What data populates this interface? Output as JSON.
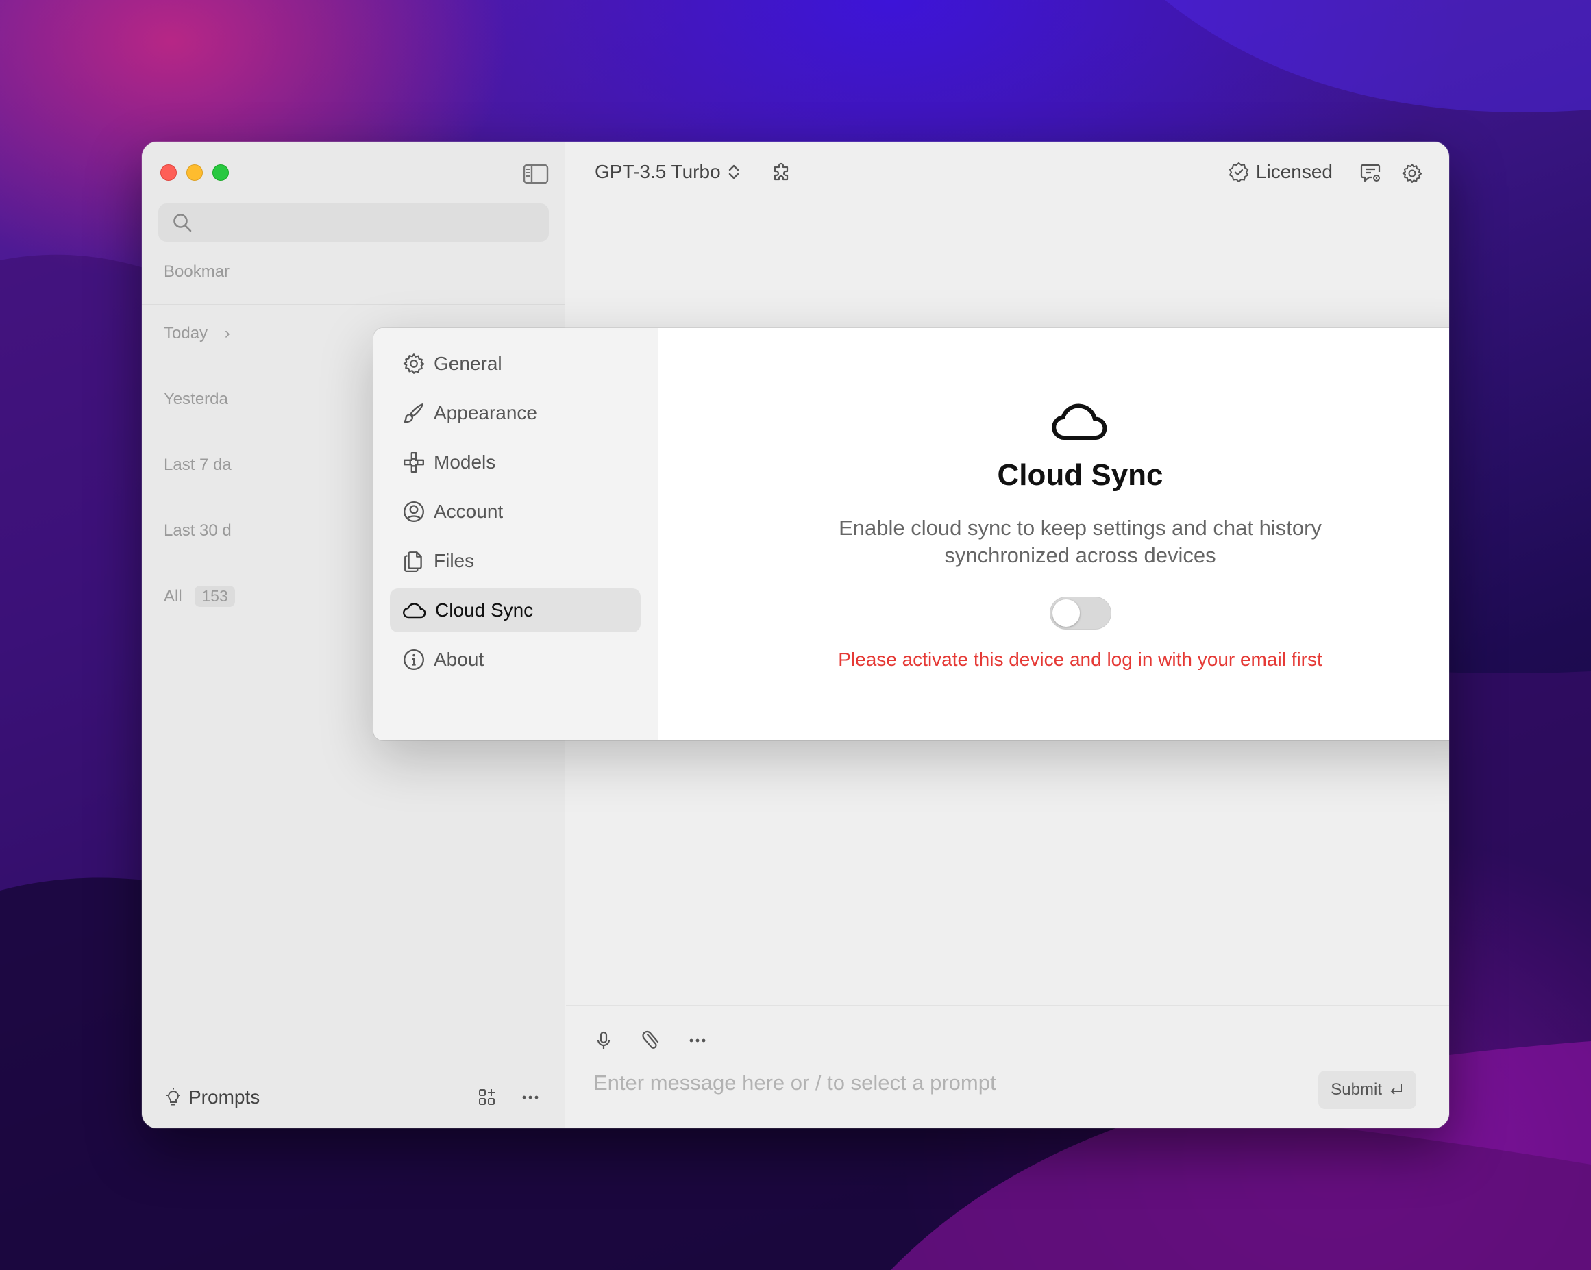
{
  "sidebar": {
    "search_placeholder": "",
    "sections": {
      "bookmarks": "Bookmar",
      "today": "Today",
      "today_chevron": "›",
      "yesterday": "Yesterda",
      "last7": "Last 7 da",
      "last30": "Last 30 d",
      "all": "All",
      "all_count": "153"
    },
    "footer": {
      "prompts_label": "Prompts"
    }
  },
  "topbar": {
    "model": "GPT-3.5 Turbo",
    "license_label": "Licensed"
  },
  "composer": {
    "placeholder": "Enter message here or / to select a prompt",
    "submit_label": "Submit"
  },
  "settings": {
    "nav": [
      {
        "label": "General",
        "icon": "gear-icon"
      },
      {
        "label": "Appearance",
        "icon": "brush-icon"
      },
      {
        "label": "Models",
        "icon": "models-icon"
      },
      {
        "label": "Account",
        "icon": "user-circle-icon"
      },
      {
        "label": "Files",
        "icon": "files-icon"
      },
      {
        "label": "Cloud Sync",
        "icon": "cloud-icon",
        "active": true
      },
      {
        "label": "About",
        "icon": "info-icon"
      }
    ],
    "cloud_sync": {
      "title": "Cloud Sync",
      "description": "Enable cloud sync to keep settings and chat history synchronized across devices",
      "toggle_enabled": false,
      "error": "Please activate this device and log in with your email first"
    }
  },
  "colors": {
    "error": "#e53935",
    "active_nav_bg": "#e2e2e2",
    "window_bg": "#efefef"
  }
}
